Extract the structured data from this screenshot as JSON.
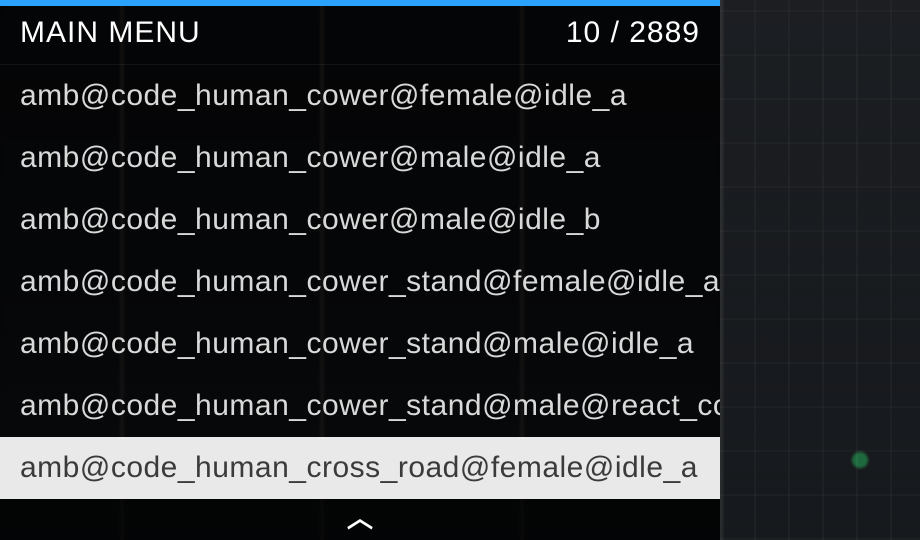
{
  "menu": {
    "title": "MAIN MENU",
    "index": 10,
    "total": 2889,
    "counter_text": "10 / 2889",
    "items": [
      "amb@code_human_cower@female@idle_a",
      "amb@code_human_cower@male@idle_a",
      "amb@code_human_cower@male@idle_b",
      "amb@code_human_cower_stand@female@idle_a",
      "amb@code_human_cower_stand@male@idle_a",
      "amb@code_human_cower_stand@male@react_cow",
      "amb@code_human_cross_road@female@idle_a"
    ],
    "selected_index": 6,
    "scroll_arrow": "︿"
  }
}
